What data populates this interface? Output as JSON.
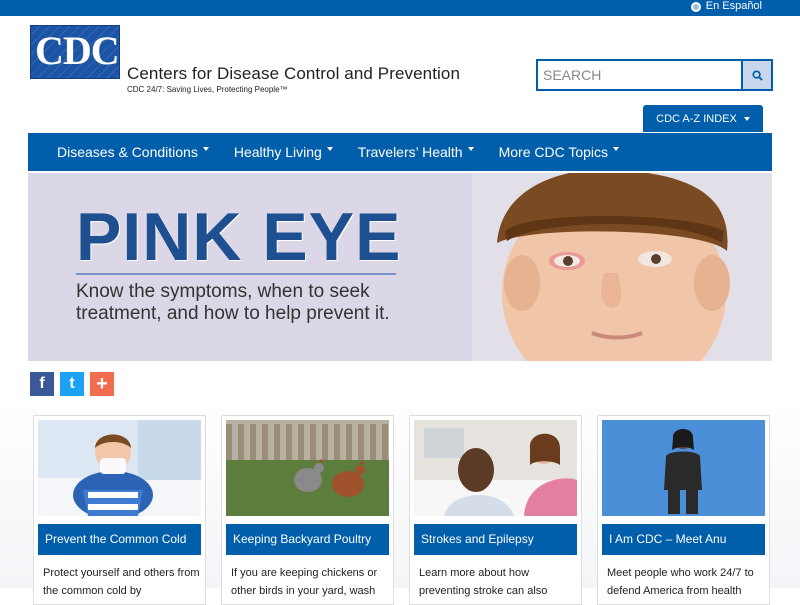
{
  "topbar": {
    "lang_label": "En Español"
  },
  "header": {
    "logo_text": "CDC",
    "org_name": "Centers for Disease Control and Prevention",
    "tagline": "CDC 24/7: Saving Lives, Protecting People™",
    "search_placeholder": "SEARCH",
    "az_label": "CDC A-Z INDEX"
  },
  "nav": [
    {
      "label": "Diseases & Conditions"
    },
    {
      "label": "Healthy Living"
    },
    {
      "label": "Travelers’ Health"
    },
    {
      "label": "More CDC Topics"
    }
  ],
  "hero": {
    "title": "PINK EYE",
    "subtitle": "Know the symptoms, when to seek treatment, and how to help prevent it."
  },
  "social": [
    {
      "icon": "facebook-icon",
      "glyph": "f"
    },
    {
      "icon": "twitter-icon",
      "glyph": "t"
    },
    {
      "icon": "add-share-icon",
      "glyph": "+"
    }
  ],
  "cards": [
    {
      "title": "Prevent the Common Cold",
      "text": "Protect yourself and others from the common cold by"
    },
    {
      "title": "Keeping Backyard Poultry",
      "text": "If you are keeping chickens or other birds in your yard, wash"
    },
    {
      "title": "Strokes and Epilepsy",
      "text": "Learn more about how preventing stroke can also"
    },
    {
      "title": "I Am CDC – Meet Anu",
      "text": "Meet people who work 24/7 to defend America from health"
    }
  ],
  "colors": {
    "brand_blue": "#005eaa",
    "hero_bg": "#dcd7e6",
    "hero_title": "#1d4f91"
  }
}
